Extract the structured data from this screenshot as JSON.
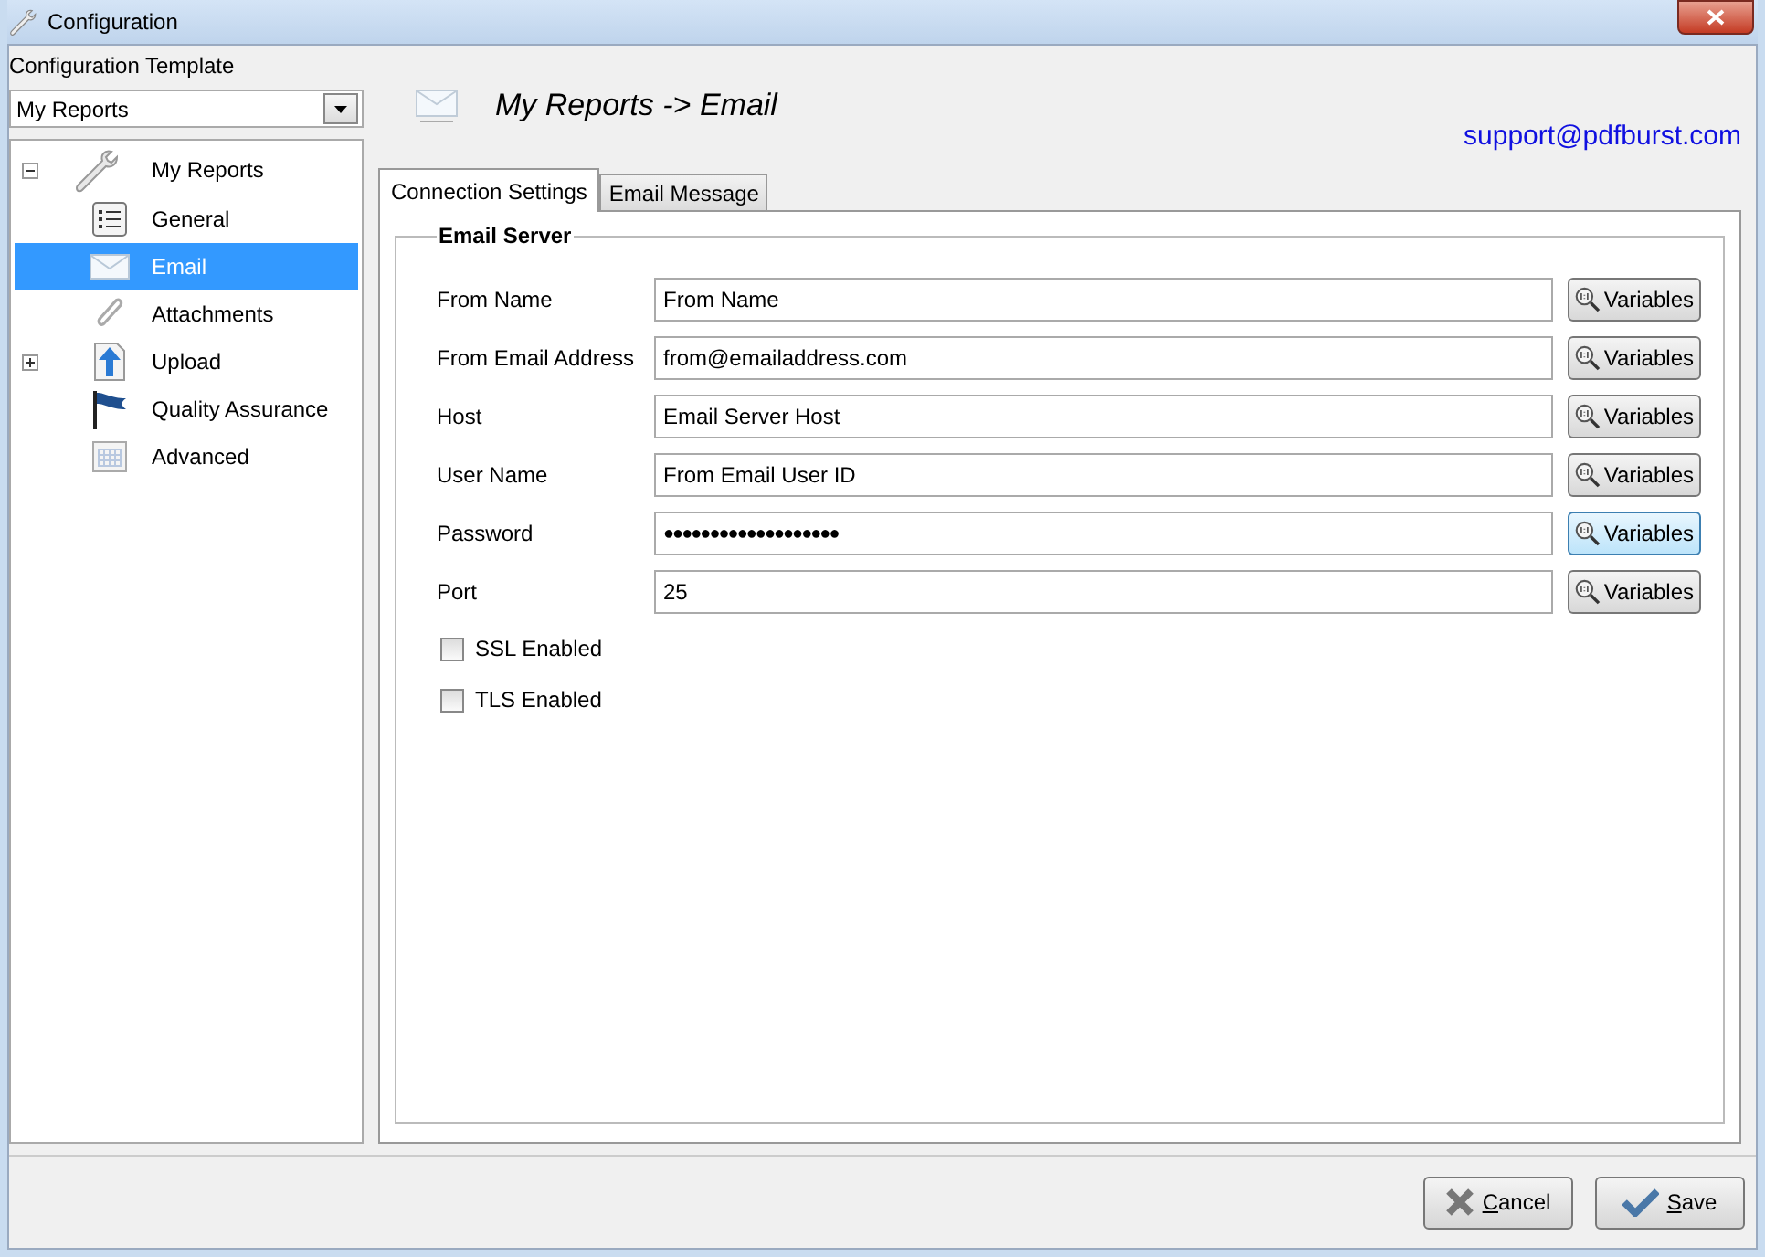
{
  "window": {
    "title": "Configuration"
  },
  "template": {
    "label": "Configuration Template",
    "value": "My Reports"
  },
  "tree": [
    {
      "label": "My Reports",
      "expanded": true,
      "selected": false,
      "children": [
        {
          "label": "General",
          "selected": false
        },
        {
          "label": "Email",
          "selected": true
        },
        {
          "label": "Attachments",
          "selected": false
        },
        {
          "label": "Upload",
          "selected": false,
          "expanded": false
        },
        {
          "label": "Quality Assurance",
          "selected": false
        },
        {
          "label": "Advanced",
          "selected": false
        }
      ]
    }
  ],
  "header": {
    "title": "My Reports -> Email",
    "link": "support@pdfburst.com"
  },
  "tabs": [
    {
      "label": "Connection Settings",
      "selected": true
    },
    {
      "label": "Email Message",
      "selected": false
    }
  ],
  "group": {
    "title": "Email Server"
  },
  "fields": [
    {
      "label": "From Name",
      "value": "From Name",
      "button": "Variables",
      "hovered": false
    },
    {
      "label": "From Email Address",
      "value": "from@emailaddress.com",
      "button": "Variables",
      "hovered": false
    },
    {
      "label": "Host",
      "value": "Email Server Host",
      "button": "Variables",
      "hovered": false
    },
    {
      "label": "User Name",
      "value": "From Email User ID",
      "button": "Variables",
      "hovered": false
    },
    {
      "label": "Password",
      "value": "●●●●●●●●●●●●●●●●●●●",
      "button": "Variables",
      "hovered": true
    },
    {
      "label": "Port",
      "value": "25",
      "button": "Variables",
      "hovered": false
    }
  ],
  "checkboxes": [
    {
      "label": "SSL Enabled",
      "checked": false
    },
    {
      "label": "TLS Enabled",
      "checked": false
    }
  ],
  "buttons": [
    {
      "kind": "cancel",
      "label": "Cancel"
    },
    {
      "kind": "save",
      "label": "Save"
    }
  ]
}
